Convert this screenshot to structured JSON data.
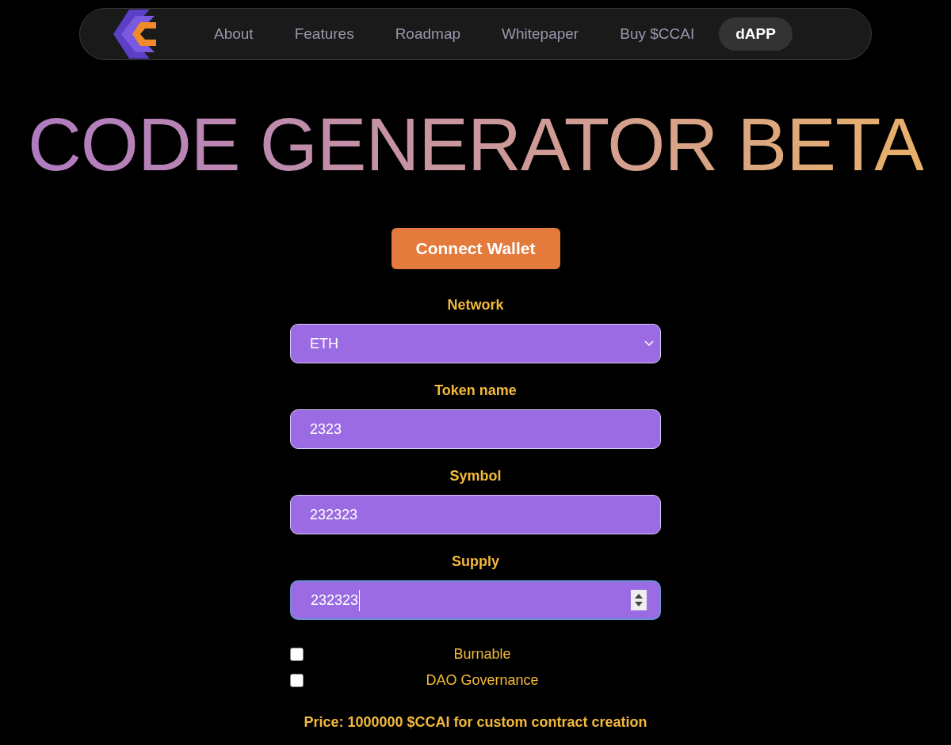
{
  "nav": {
    "items": [
      {
        "label": "About",
        "selected": false
      },
      {
        "label": "Features",
        "selected": false
      },
      {
        "label": "Roadmap",
        "selected": false
      },
      {
        "label": "Whitepaper",
        "selected": false
      },
      {
        "label": "Buy $CCAI",
        "selected": false
      },
      {
        "label": "dAPP",
        "selected": true
      }
    ]
  },
  "title": "CODE GENERATOR BETA",
  "connect_button": "Connect Wallet",
  "fields": [
    {
      "kind": "select",
      "label": "Network",
      "value": "ETH"
    },
    {
      "kind": "text",
      "label": "Token name",
      "value": "2323"
    },
    {
      "kind": "text",
      "label": "Symbol",
      "value": "232323"
    },
    {
      "kind": "number",
      "label": "Supply",
      "value": "232323"
    }
  ],
  "options": [
    {
      "label": "Burnable",
      "checked": false
    },
    {
      "label": "DAO Governance",
      "checked": false
    }
  ],
  "price": "Price: 1000000 $CCAI for custom contract creation"
}
